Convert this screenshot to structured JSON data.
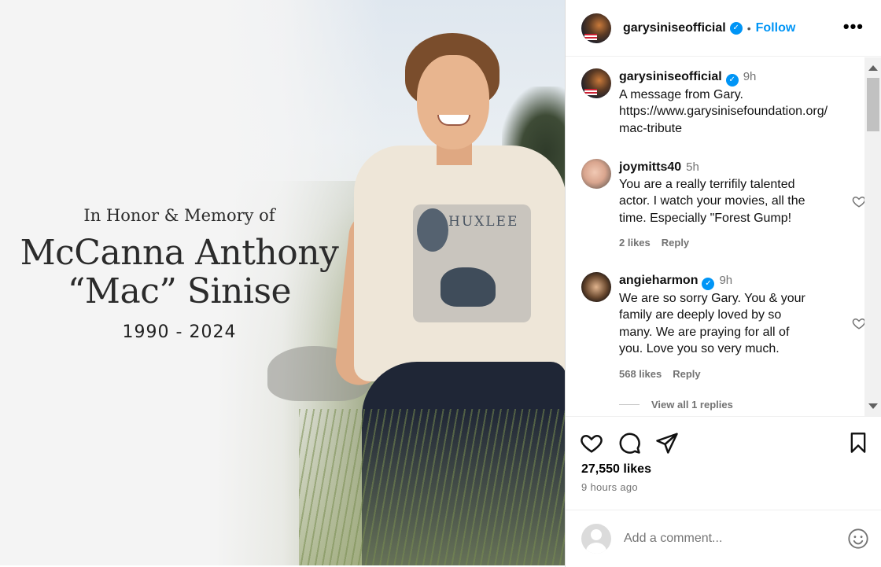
{
  "memorial": {
    "honor_line": "In Honor & Memory of",
    "name_line1": "McCanna Anthony",
    "name_line2": "“Mac” Sinise",
    "years": "1990 - 2024",
    "shirt_print": "HUXLEE"
  },
  "header": {
    "username": "garysiniseofficial",
    "separator": "•",
    "follow_label": "Follow",
    "more_label": "•••"
  },
  "caption": {
    "username": "garysiniseofficial",
    "time": "9h",
    "text_line1": "A message from Gary.",
    "text_line2": "https://www.garysinisefoundation.org/",
    "text_line3": "mac-tribute"
  },
  "comments": [
    {
      "username": "joymitts40",
      "time": "5h",
      "lines": [
        "You are a really terrifily talented",
        "actor. I watch your movies, all the",
        "time. Especially \"Forest Gump!"
      ],
      "likes": "2 likes",
      "reply": "Reply"
    },
    {
      "username": "angieharmon",
      "time": "9h",
      "lines": [
        "We are so sorry Gary. You & your",
        "family are deeply loved by so",
        "many. We are praying for all of",
        "you. Love you so very much."
      ],
      "likes": "568 likes",
      "reply": "Reply"
    }
  ],
  "view_replies": "View all 1 replies",
  "stats": {
    "likes": "27,550 likes",
    "posted": "9 hours ago"
  },
  "add_comment": {
    "placeholder": "Add a comment..."
  },
  "colors": {
    "accent": "#0095f6",
    "muted": "#737373"
  },
  "icons": [
    "verified-badge-icon",
    "heart-icon",
    "comment-icon",
    "share-icon",
    "bookmark-icon",
    "emoji-icon"
  ]
}
